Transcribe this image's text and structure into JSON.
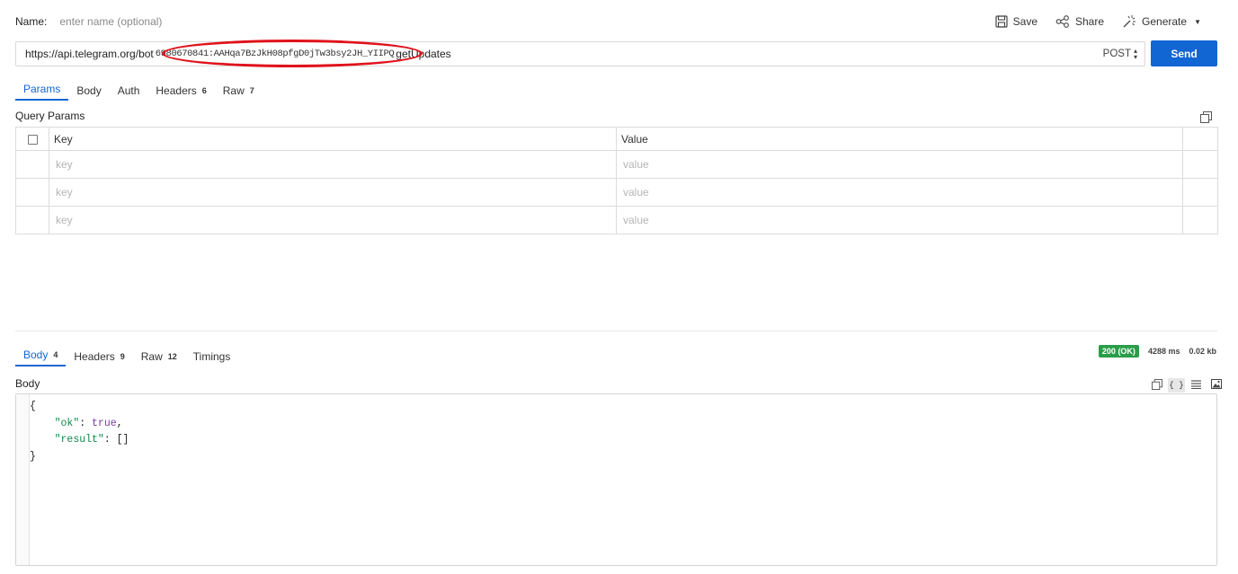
{
  "header": {
    "name_label": "Name:",
    "name_placeholder": "enter name (optional)",
    "save_label": "Save",
    "share_label": "Share",
    "generate_label": "Generate"
  },
  "request": {
    "url_prefix": "https://api.telegram.org/bot",
    "url_token": "6980670841:AAHqa7BzJkH08pfgD0jTw3bsy2JH_YIIPQ",
    "url_suffix": "getUpdates",
    "method": "POST",
    "send_label": "Send",
    "tabs": [
      {
        "label": "Params",
        "count": ""
      },
      {
        "label": "Body",
        "count": ""
      },
      {
        "label": "Auth",
        "count": ""
      },
      {
        "label": "Headers",
        "count": "6"
      },
      {
        "label": "Raw",
        "count": "7"
      }
    ],
    "query_params_title": "Query Params",
    "table": {
      "key_header": "Key",
      "value_header": "Value",
      "key_placeholder": "key",
      "value_placeholder": "value"
    }
  },
  "response": {
    "tabs": [
      {
        "label": "Body",
        "count": "4"
      },
      {
        "label": "Headers",
        "count": "9"
      },
      {
        "label": "Raw",
        "count": "12"
      },
      {
        "label": "Timings",
        "count": ""
      }
    ],
    "status": "200 (OK)",
    "time": "4288 ms",
    "size": "0.02 kb",
    "status_color": "#2a9d48",
    "body_title": "Body",
    "body_lines": {
      "open": "{",
      "ok_key": "\"ok\"",
      "ok_value": "true",
      "result_key": "\"result\"",
      "result_value": "[]",
      "close": "}"
    },
    "view_toggle": "{ }"
  },
  "colors": {
    "accent": "#1266d3",
    "annotation": "#e0121b"
  }
}
